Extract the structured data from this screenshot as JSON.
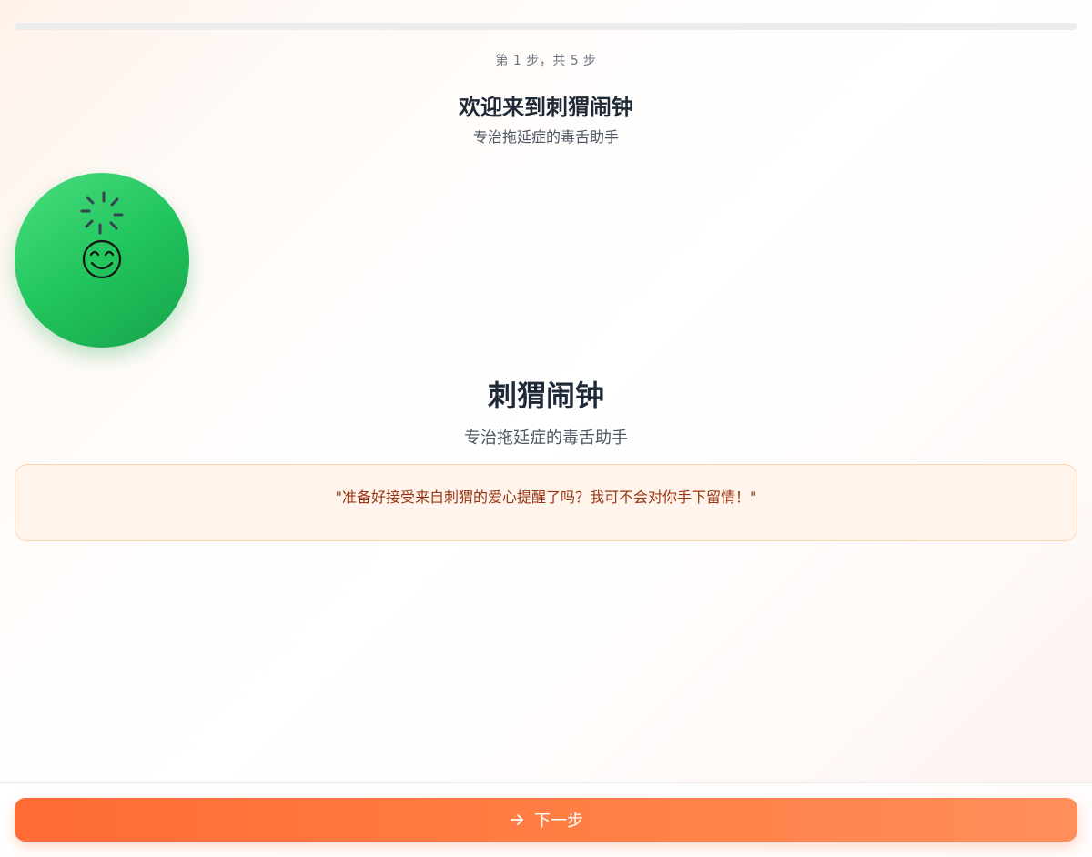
{
  "progress": {
    "current_step": 1,
    "total_steps": 5,
    "fraction": 0.0,
    "label": "第 1 步，共 5 步"
  },
  "header": {
    "title": "欢迎来到刺猬闹钟",
    "subtitle": "专治拖延症的毒舌助手"
  },
  "mascot": {
    "icon": "hedgehog-mascot-icon",
    "background_color": "#22c55e"
  },
  "main": {
    "app_name": "刺猬闹钟",
    "tagline": "专治拖延症的毒舌助手",
    "quote": "\"准备好接受来自刺猬的爱心提醒了吗？我可不会对你手下留情！\""
  },
  "footer": {
    "next_label": "下一步",
    "next_icon": "arrow-right-icon"
  },
  "colors": {
    "accent": "#ff6b35",
    "quote_text": "#9a3412",
    "quote_border": "#fdd4b0",
    "quote_background": "#fff5ec"
  }
}
